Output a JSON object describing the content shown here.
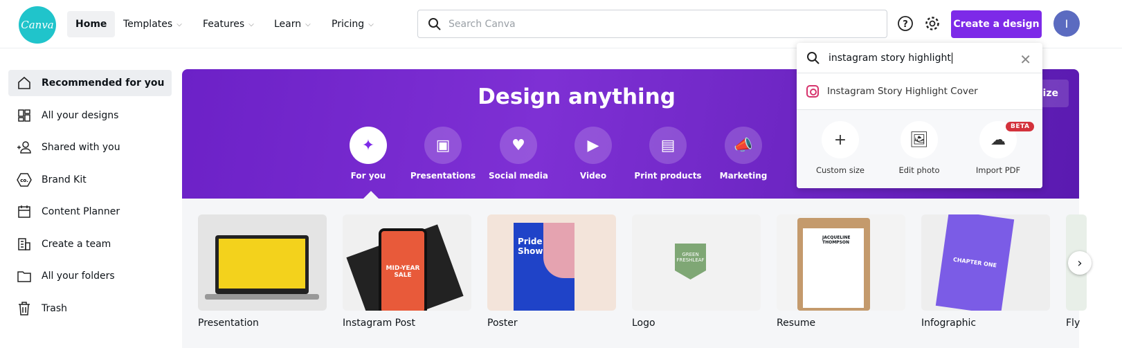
{
  "header": {
    "logo": "Canva",
    "nav": [
      {
        "label": "Home"
      },
      {
        "label": "Templates"
      },
      {
        "label": "Features"
      },
      {
        "label": "Learn"
      },
      {
        "label": "Pricing"
      }
    ],
    "search_placeholder": "Search Canva",
    "create_label": "Create a design",
    "avatar_initial": "I",
    "accent": "#7d2ae8"
  },
  "sidebar": {
    "items": [
      {
        "label": "Recommended for you",
        "icon": "home-icon"
      },
      {
        "label": "All your designs",
        "icon": "grid-icon"
      },
      {
        "label": "Shared with you",
        "icon": "users-icon"
      },
      {
        "label": "Brand Kit",
        "icon": "brand-icon"
      },
      {
        "label": "Content Planner",
        "icon": "calendar-icon"
      },
      {
        "label": "Create a team",
        "icon": "team-icon"
      },
      {
        "label": "All your folders",
        "icon": "folder-icon"
      },
      {
        "label": "Trash",
        "icon": "trash-icon"
      }
    ]
  },
  "banner": {
    "title": "Design anything",
    "size_btn": "size",
    "categories": [
      {
        "label": "For you",
        "glyph": "✦"
      },
      {
        "label": "Presentations",
        "glyph": "▣"
      },
      {
        "label": "Social media",
        "glyph": "♥"
      },
      {
        "label": "Video",
        "glyph": "▶"
      },
      {
        "label": "Print products",
        "glyph": "▤"
      },
      {
        "label": "Marketing",
        "glyph": "📣"
      }
    ]
  },
  "templates": [
    {
      "label": "Presentation"
    },
    {
      "label": "Instagram Post"
    },
    {
      "label": "Poster"
    },
    {
      "label": "Logo"
    },
    {
      "label": "Resume"
    },
    {
      "label": "Infographic"
    },
    {
      "label": "Fly"
    }
  ],
  "thumb_text": {
    "poster": "Pride Art Showcase",
    "logo": "GREEN FRESHLEAF",
    "resume": "JACQUELINE THOMPSON",
    "ig": "MID-YEAR SALE",
    "info": "CHAPTER ONE"
  },
  "dropdown": {
    "query": "instagram story highlight",
    "suggestion": "Instagram Story Highlight Cover",
    "actions": [
      {
        "label": "Custom size",
        "glyph": "+"
      },
      {
        "label": "Edit photo",
        "glyph": "🖼"
      },
      {
        "label": "Import PDF",
        "glyph": "☁"
      }
    ],
    "beta": "BETA"
  }
}
